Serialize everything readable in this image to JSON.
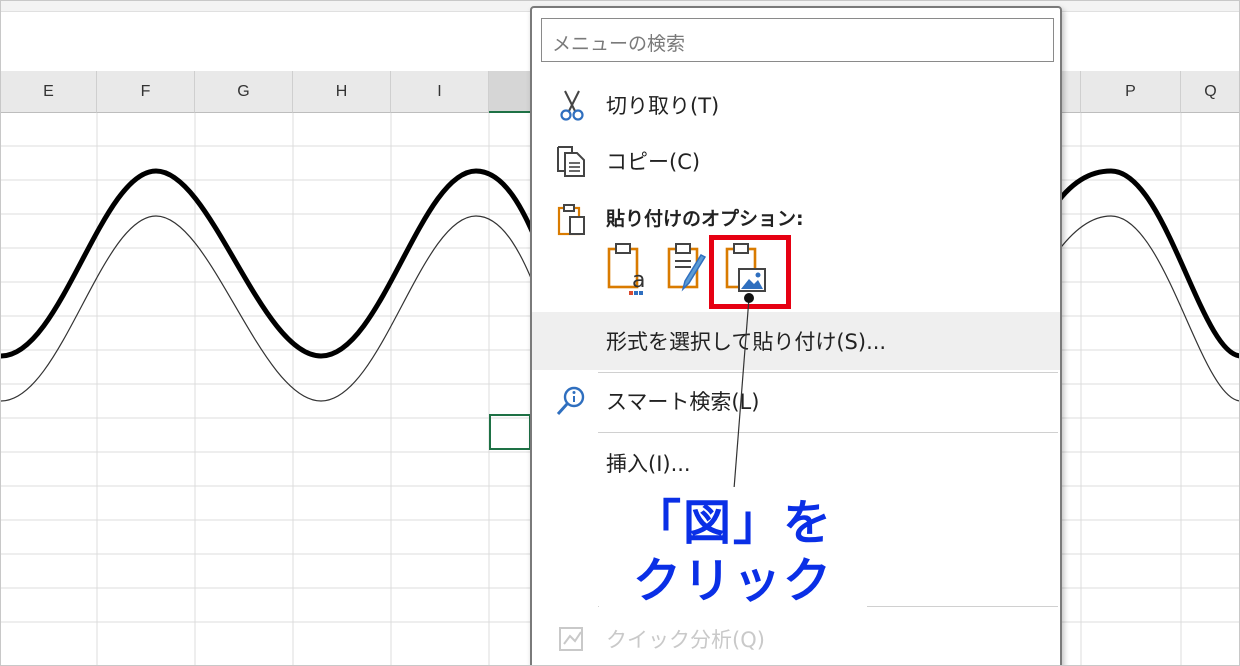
{
  "columns": [
    "E",
    "F",
    "G",
    "H",
    "I",
    "",
    "P",
    "Q"
  ],
  "menu": {
    "search_placeholder": "メニューの検索",
    "cut": "切り取り(T)",
    "copy": "コピー(C)",
    "paste_options": "貼り付けのオプション:",
    "paste_special": "形式を選択して貼り付け(S)...",
    "smart_lookup": "スマート検索(L)",
    "insert": "挿入(I)...",
    "hidden_item": "クイック分析(Q)"
  },
  "paste_option_icons": [
    "paste-keep-text-icon",
    "paste-formatting-icon",
    "paste-picture-icon"
  ],
  "annotation": {
    "line1": "「図」を",
    "line2": "クリック",
    "color": "#0a2fe6",
    "highlight_color": "#e60012"
  }
}
